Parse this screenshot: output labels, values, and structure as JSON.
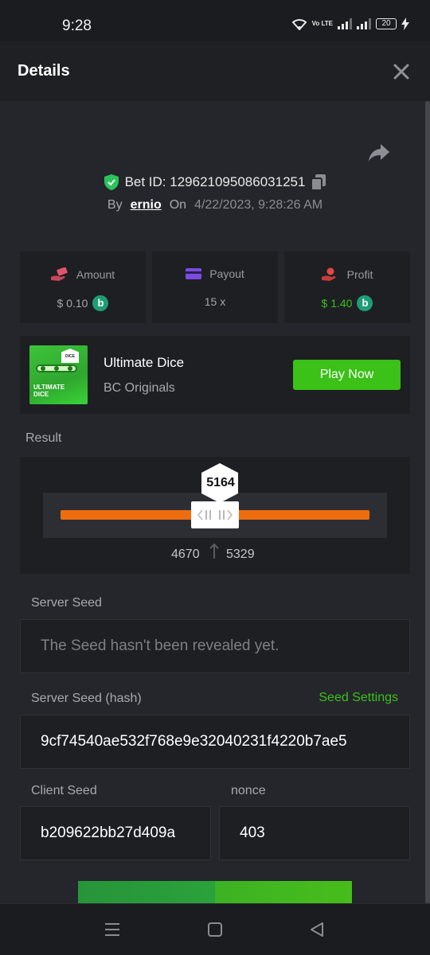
{
  "status_bar": {
    "time": "9:28",
    "network_label": "Vo LTE",
    "battery": "20"
  },
  "header": {
    "title": "Details"
  },
  "bet": {
    "id_text": "Bet ID: 129621095086031251",
    "by_label": "By",
    "user": "ernio",
    "on_label": "On",
    "datetime": "4/22/2023, 9:28:26 AM"
  },
  "stats": [
    {
      "label": "Amount",
      "value": "$ 0.10",
      "icon": "money-hand-icon",
      "color": "#e2546b"
    },
    {
      "label": "Payout",
      "value": "15 x",
      "icon": "wallet-card-icon",
      "color": "#7a4ce0"
    },
    {
      "label": "Profit",
      "value": "$ 1.40",
      "icon": "profit-hand-icon",
      "color": "#e04848",
      "value_color": "#3bc117"
    }
  ],
  "game": {
    "name": "Ultimate Dice",
    "provider": "BC Originals",
    "play_label": "Play Now",
    "thumb_title": "ULTIMATE DICE",
    "thumb_badge": "DICE"
  },
  "result": {
    "label": "Result",
    "value": "5164",
    "range_low": "4670",
    "range_high": "5329",
    "bar_color": "#ee6c10"
  },
  "server_seed": {
    "label": "Server Seed",
    "value": "The Seed hasn't been revealed yet."
  },
  "server_seed_hash": {
    "label": "Server Seed (hash)",
    "settings_label": "Seed Settings",
    "value": "9cf74540ae532f768e9e32040231f4220b7ae5"
  },
  "client_seed": {
    "label": "Client Seed",
    "value": "b209622bb27d409a"
  },
  "nonce": {
    "label": "nonce",
    "value": "403"
  },
  "colors": {
    "accent": "#3bc117",
    "background": "#24262b",
    "card": "#1d1f23"
  }
}
